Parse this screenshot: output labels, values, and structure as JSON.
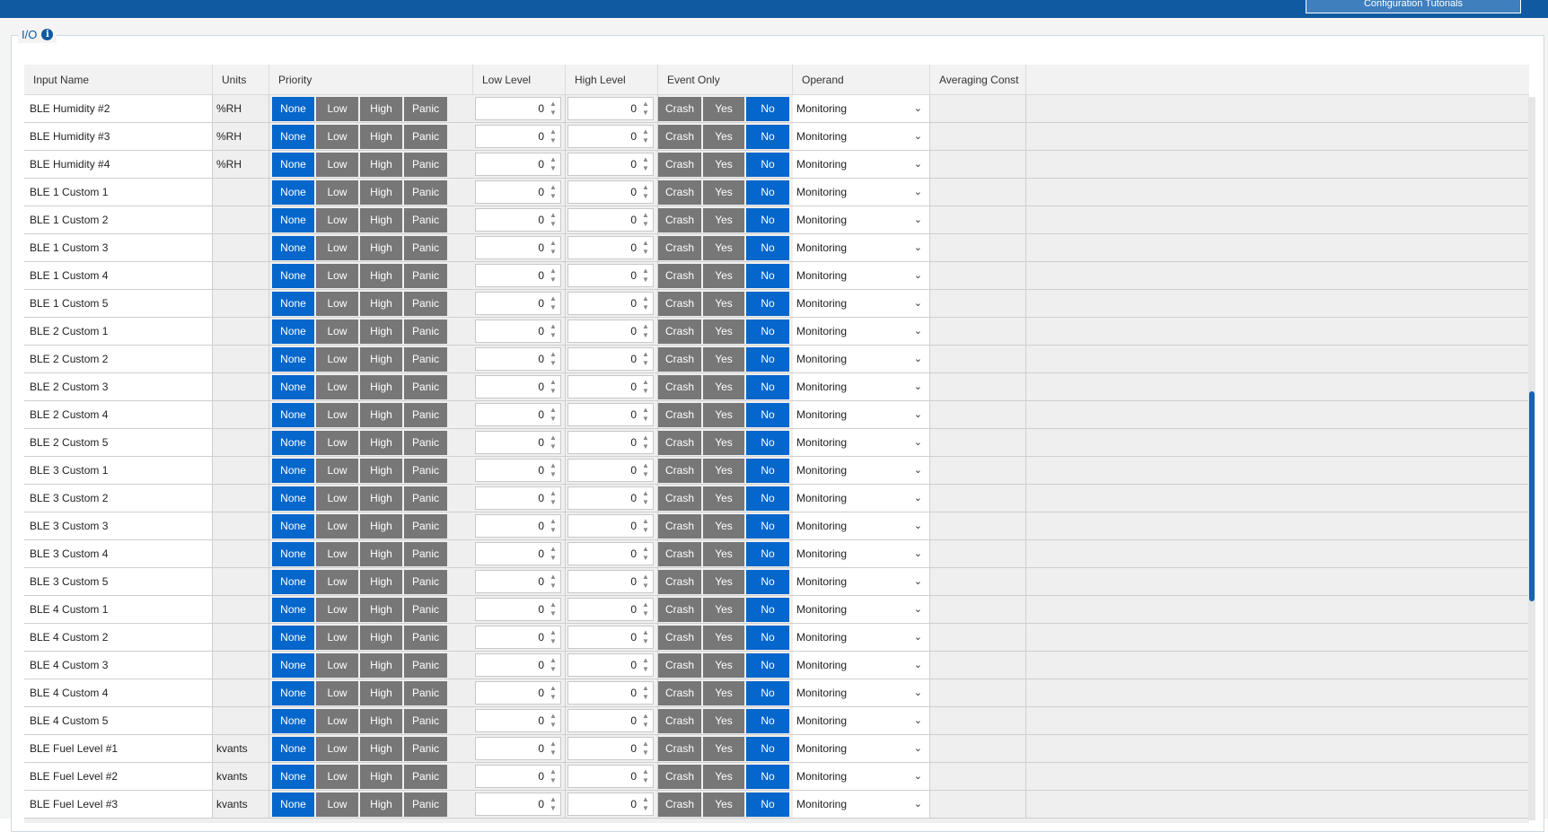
{
  "window": {
    "top_button_label": "Configuration Tutorials"
  },
  "group": {
    "title": "I/O",
    "info_icon": "info-icon"
  },
  "columns": {
    "input_name": "Input Name",
    "units": "Units",
    "priority": "Priority",
    "low_level": "Low Level",
    "high_level": "High Level",
    "event_only": "Event Only",
    "operand": "Operand",
    "averaging_const": "Averaging Const"
  },
  "priority_options": [
    "None",
    "Low",
    "High",
    "Panic"
  ],
  "event_options": [
    "Crash",
    "Yes",
    "No"
  ],
  "colors": {
    "selected": "#0566cc",
    "unselected": "#777777",
    "header_bar": "#0f5aa0"
  },
  "rows": [
    {
      "name": "BLE Humidity #2",
      "units": "%RH",
      "priority": "None",
      "low": "0",
      "high": "0",
      "event": "No",
      "operand": "Monitoring"
    },
    {
      "name": "BLE Humidity #3",
      "units": "%RH",
      "priority": "None",
      "low": "0",
      "high": "0",
      "event": "No",
      "operand": "Monitoring"
    },
    {
      "name": "BLE Humidity #4",
      "units": "%RH",
      "priority": "None",
      "low": "0",
      "high": "0",
      "event": "No",
      "operand": "Monitoring"
    },
    {
      "name": "BLE 1 Custom 1",
      "units": "",
      "priority": "None",
      "low": "0",
      "high": "0",
      "event": "No",
      "operand": "Monitoring"
    },
    {
      "name": "BLE 1 Custom 2",
      "units": "",
      "priority": "None",
      "low": "0",
      "high": "0",
      "event": "No",
      "operand": "Monitoring"
    },
    {
      "name": "BLE 1 Custom 3",
      "units": "",
      "priority": "None",
      "low": "0",
      "high": "0",
      "event": "No",
      "operand": "Monitoring"
    },
    {
      "name": "BLE 1 Custom 4",
      "units": "",
      "priority": "None",
      "low": "0",
      "high": "0",
      "event": "No",
      "operand": "Monitoring"
    },
    {
      "name": "BLE 1 Custom 5",
      "units": "",
      "priority": "None",
      "low": "0",
      "high": "0",
      "event": "No",
      "operand": "Monitoring"
    },
    {
      "name": "BLE 2 Custom 1",
      "units": "",
      "priority": "None",
      "low": "0",
      "high": "0",
      "event": "No",
      "operand": "Monitoring"
    },
    {
      "name": "BLE 2 Custom 2",
      "units": "",
      "priority": "None",
      "low": "0",
      "high": "0",
      "event": "No",
      "operand": "Monitoring"
    },
    {
      "name": "BLE 2 Custom 3",
      "units": "",
      "priority": "None",
      "low": "0",
      "high": "0",
      "event": "No",
      "operand": "Monitoring"
    },
    {
      "name": "BLE 2 Custom 4",
      "units": "",
      "priority": "None",
      "low": "0",
      "high": "0",
      "event": "No",
      "operand": "Monitoring"
    },
    {
      "name": "BLE 2 Custom 5",
      "units": "",
      "priority": "None",
      "low": "0",
      "high": "0",
      "event": "No",
      "operand": "Monitoring"
    },
    {
      "name": "BLE 3 Custom 1",
      "units": "",
      "priority": "None",
      "low": "0",
      "high": "0",
      "event": "No",
      "operand": "Monitoring"
    },
    {
      "name": "BLE 3 Custom 2",
      "units": "",
      "priority": "None",
      "low": "0",
      "high": "0",
      "event": "No",
      "operand": "Monitoring"
    },
    {
      "name": "BLE 3 Custom 3",
      "units": "",
      "priority": "None",
      "low": "0",
      "high": "0",
      "event": "No",
      "operand": "Monitoring"
    },
    {
      "name": "BLE 3 Custom 4",
      "units": "",
      "priority": "None",
      "low": "0",
      "high": "0",
      "event": "No",
      "operand": "Monitoring"
    },
    {
      "name": "BLE 3 Custom 5",
      "units": "",
      "priority": "None",
      "low": "0",
      "high": "0",
      "event": "No",
      "operand": "Monitoring"
    },
    {
      "name": "BLE 4 Custom 1",
      "units": "",
      "priority": "None",
      "low": "0",
      "high": "0",
      "event": "No",
      "operand": "Monitoring"
    },
    {
      "name": "BLE 4 Custom 2",
      "units": "",
      "priority": "None",
      "low": "0",
      "high": "0",
      "event": "No",
      "operand": "Monitoring"
    },
    {
      "name": "BLE 4 Custom 3",
      "units": "",
      "priority": "None",
      "low": "0",
      "high": "0",
      "event": "No",
      "operand": "Monitoring"
    },
    {
      "name": "BLE 4 Custom 4",
      "units": "",
      "priority": "None",
      "low": "0",
      "high": "0",
      "event": "No",
      "operand": "Monitoring"
    },
    {
      "name": "BLE 4 Custom 5",
      "units": "",
      "priority": "None",
      "low": "0",
      "high": "0",
      "event": "No",
      "operand": "Monitoring"
    },
    {
      "name": "BLE Fuel Level #1",
      "units": "kvants",
      "priority": "None",
      "low": "0",
      "high": "0",
      "event": "No",
      "operand": "Monitoring"
    },
    {
      "name": "BLE Fuel Level #2",
      "units": "kvants",
      "priority": "None",
      "low": "0",
      "high": "0",
      "event": "No",
      "operand": "Monitoring"
    },
    {
      "name": "BLE Fuel Level #3",
      "units": "kvants",
      "priority": "None",
      "low": "0",
      "high": "0",
      "event": "No",
      "operand": "Monitoring"
    }
  ]
}
